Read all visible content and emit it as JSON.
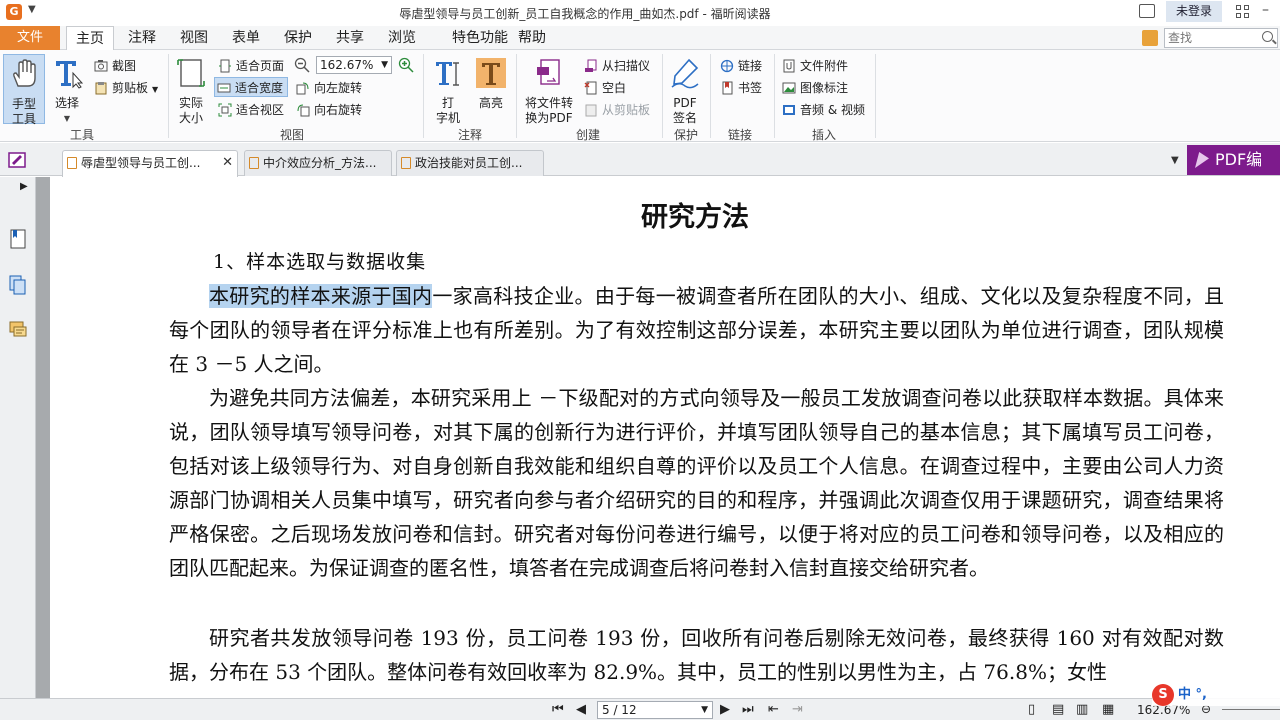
{
  "titlebar": {
    "title": "辱虐型领导与员工创新_员工自我概念的作用_曲如杰.pdf - 福昕阅读器",
    "login": "未登录"
  },
  "menu": {
    "file": "文件",
    "items": [
      "主页",
      "注释",
      "视图",
      "表单",
      "保护",
      "共享",
      "浏览",
      "特色功能",
      "帮助"
    ],
    "active": "主页",
    "search_placeholder": "查找"
  },
  "ribbon": {
    "tools": {
      "hand": "手型\n工具",
      "select": "选择",
      "screenshot": "截图",
      "clipboard": "剪贴板",
      "label": "工具"
    },
    "view": {
      "actual_size": "实际\n大小",
      "fit_page": "适合页面",
      "fit_width": "适合宽度",
      "fit_visible": "适合视区",
      "zoom": "162.67%",
      "rotate_left": "向左旋转",
      "rotate_right": "向右旋转",
      "label": "视图"
    },
    "comment": {
      "typewriter": "打\n字机",
      "highlight": "高亮",
      "label": "注释"
    },
    "create": {
      "to_pdf": "将文件转\n换为PDF",
      "from_scanner": "从扫描仪",
      "blank": "空白",
      "from_clipboard": "从剪贴板",
      "label": "创建"
    },
    "protect": {
      "sign": "PDF\n签名",
      "label": "保护"
    },
    "links": {
      "link": "链接",
      "bookmark": "书签",
      "label": "链接"
    },
    "insert": {
      "attachment": "文件附件",
      "image_annot": "图像标注",
      "audio_video": "音频 & 视频",
      "label": "插入"
    }
  },
  "tabs": [
    {
      "label": "辱虐型领导与员工创...",
      "active": true
    },
    {
      "label": "中介效应分析_方法...",
      "active": false
    },
    {
      "label": "政治技能对员工创...",
      "active": false
    }
  ],
  "pdf_edit": "PDF编",
  "document": {
    "heading": "研究方法",
    "section": "1、样本选取与数据收集",
    "p1_highlight": "本研究的样本来源于国内",
    "p1_rest": "一家高科技企业。由于每一被调查者所在团队的大小、组成、文化以及复杂程度不同，且每个团队的领导者在评分标准上也有所差别。为了有效控制这部分误差，本研究主要以团队为单位进行调查，团队规模在 3 －5 人之间。",
    "p2": "为避免共同方法偏差，本研究采用上 －下级配对的方式向领导及一般员工发放调查问卷以此获取样本数据。具体来说，团队领导填写领导问卷，对其下属的创新行为进行评价，并填写团队领导自己的基本信息；其下属填写员工问卷，包括对该上级领导行为、对自身创新自我效能和组织自尊的评价以及员工个人信息。在调查过程中，主要由公司人力资源部门协调相关人员集中填写，研究者向参与者介绍研究的目的和程序，并强调此次调查仅用于课题研究，调查结果将严格保密。之后现场发放问卷和信封。研究者对每份问卷进行编号，以便于将对应的员工问卷和领导问卷，以及相应的团队匹配起来。为保证调查的匿名性，填答者在完成调查后将问卷封入信封直接交给研究者。",
    "p3": "研究者共发放领导问卷 193 份，员工问卷 193 份，回收所有问卷后剔除无效问卷，最终获得 160 对有效配对数据，分布在 53 个团队。整体问卷有效回收率为 82.9%。其中，员工的性别以男性为主，占 76.8%；女性"
  },
  "status": {
    "page": "5 / 12",
    "zoom": "162.67%"
  },
  "ime": "中 °,"
}
